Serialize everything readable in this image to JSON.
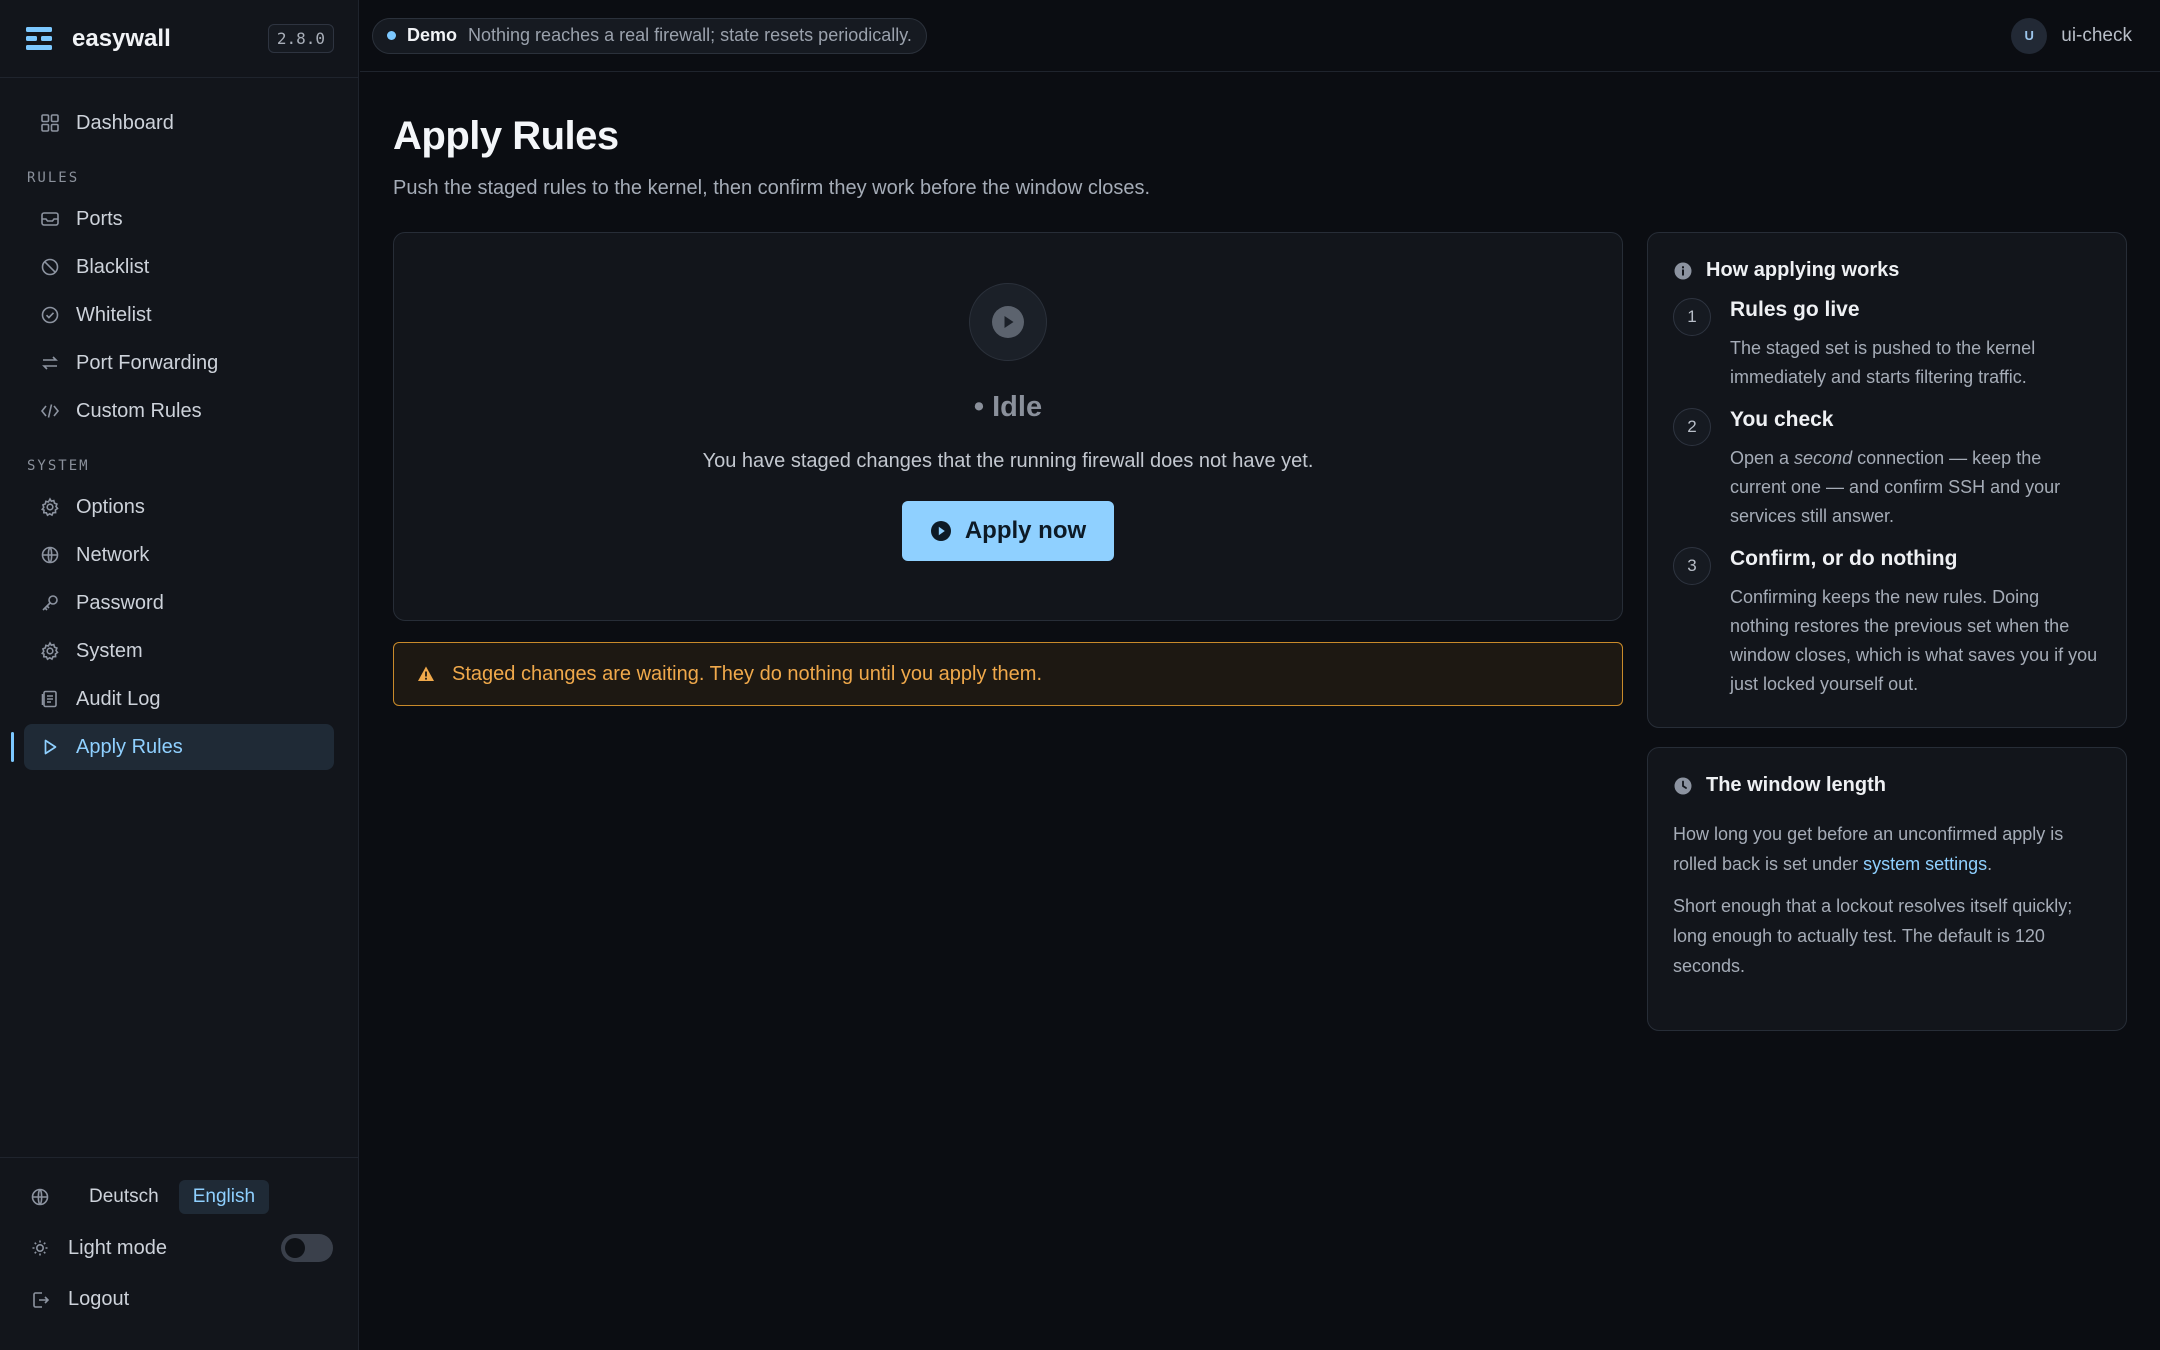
{
  "brand": {
    "name": "easywall",
    "version": "2.8.0"
  },
  "nav": {
    "dashboard": "Dashboard",
    "rules_label": "RULES",
    "rules": [
      "Ports",
      "Blacklist",
      "Whitelist",
      "Port Forwarding",
      "Custom Rules"
    ],
    "system_label": "SYSTEM",
    "system": [
      "Options",
      "Network",
      "Password",
      "System",
      "Audit Log",
      "Apply Rules"
    ],
    "active": "Apply Rules"
  },
  "sidebar_bottom": {
    "languages": [
      "Deutsch",
      "English"
    ],
    "selected_language": "English",
    "light_mode": "Light mode",
    "light_mode_on": false,
    "logout": "Logout"
  },
  "topbar": {
    "demo_label": "Demo",
    "demo_message": "Nothing reaches a real firewall; state resets periodically.",
    "user_initial": "U",
    "user_name": "ui-check"
  },
  "page": {
    "title": "Apply Rules",
    "subtitle": "Push the staged rules to the kernel, then confirm they work before the window closes."
  },
  "apply": {
    "status": "• Idle",
    "description": "You have staged changes that the running firewall does not have yet.",
    "button": "Apply now"
  },
  "warning": "Staged changes are waiting. They do nothing until you apply them.",
  "how": {
    "title": "How applying works",
    "steps": [
      {
        "num": "1",
        "title": "Rules go live",
        "body": "The staged set is pushed to the kernel immediately and starts filtering traffic."
      },
      {
        "num": "2",
        "title": "You check",
        "body_pre": "Open a ",
        "body_em": "second",
        "body_post": " connection — keep the current one — and confirm SSH and your services still answer."
      },
      {
        "num": "3",
        "title": "Confirm, or do nothing",
        "body": "Confirming keeps the new rules. Doing nothing restores the previous set when the window closes, which is what saves you if you just locked yourself out."
      }
    ]
  },
  "window": {
    "title": "The window length",
    "p1_pre": "How long you get before an unconfirmed apply is rolled back is set under ",
    "p1_link": "system settings",
    "p1_post": ".",
    "p2": "Short enough that a lockout resolves itself quickly; long enough to actually test. The default is 120 seconds."
  },
  "colors": {
    "accent": "#8fd0ff",
    "warning": "#f0a94b",
    "background": "#0b0d12"
  }
}
